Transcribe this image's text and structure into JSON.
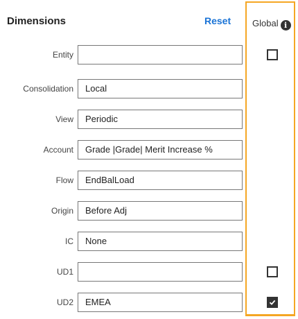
{
  "header": {
    "title": "Dimensions",
    "reset_label": "Reset",
    "global_label": "Global",
    "info_icon": "i"
  },
  "fields": [
    {
      "label": "Entity",
      "value": "",
      "global_checkbox": "unchecked"
    },
    {
      "label": "Consolidation",
      "value": "Local"
    },
    {
      "label": "View",
      "value": "Periodic"
    },
    {
      "label": "Account",
      "value": "Grade |Grade| Merit Increase %"
    },
    {
      "label": "Flow",
      "value": "EndBalLoad"
    },
    {
      "label": "Origin",
      "value": "Before Adj"
    },
    {
      "label": "IC",
      "value": "None"
    },
    {
      "label": "UD1",
      "value": "",
      "global_checkbox": "unchecked"
    },
    {
      "label": "UD2",
      "value": "EMEA",
      "global_checkbox": "checked"
    }
  ],
  "colors": {
    "accent_border": "#f5a623",
    "reset_link": "#1a73d6"
  }
}
